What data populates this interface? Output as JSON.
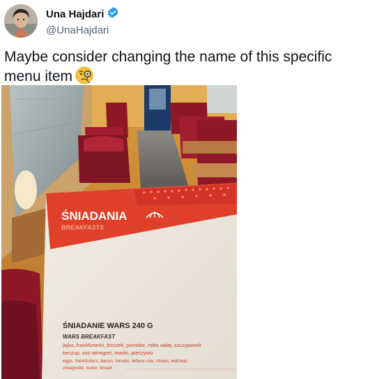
{
  "author": {
    "name": "Una Hajdari",
    "handle": "@UnaHajdari",
    "verified": true,
    "verified_color": "#1d9bf0"
  },
  "tweet": {
    "text": "Maybe consider changing the name of this specific menu item",
    "emoji": "face-with-monocle"
  },
  "photo": {
    "menu_heading": "ŚNIADANIA",
    "menu_heading_en": "BREAKFASTS",
    "item_title": "ŚNIADANIE WARS 240 G",
    "item_subtitle": "WARS BREAKFAST",
    "item_desc_pl_1": "jajka, frankfurterki, boczek, pomidor, miks sałat, szczypiorek",
    "item_desc_pl_2": "keczup, sos winegret, masło, pieczywo",
    "item_desc_en_1": "eggs, frankfurters, bacon, tomato, lettuce mix, chives, ketchup,",
    "item_desc_en_2": "vinaigrette, butter, bread"
  },
  "colors": {
    "menu_red": "#e0402a",
    "seat_red": "#8e1828",
    "text_dark": "#0f1419",
    "text_muted": "#536471"
  }
}
